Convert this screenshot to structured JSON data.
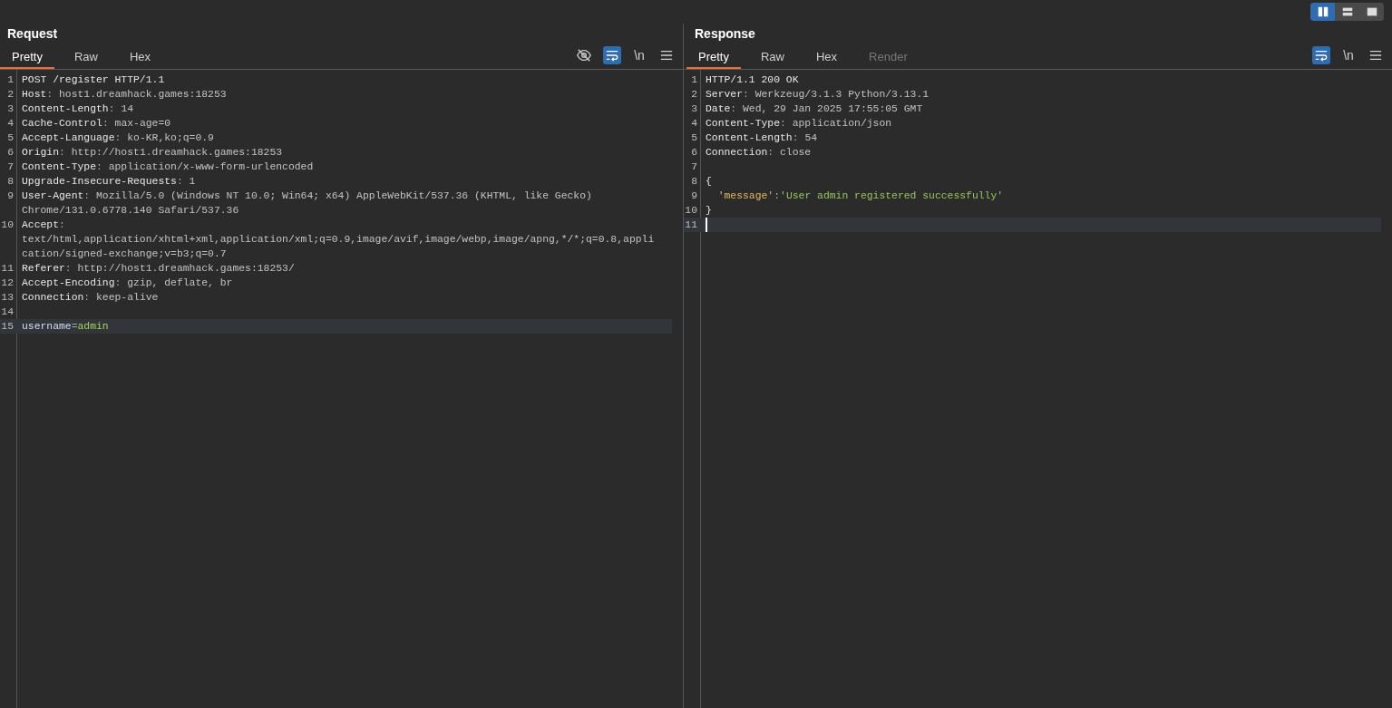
{
  "view_toggles": [
    {
      "kind": "columns",
      "selected": true
    },
    {
      "kind": "rows",
      "selected": false
    },
    {
      "kind": "single",
      "selected": false
    }
  ],
  "panels": [
    {
      "title": "Request",
      "tabs": [
        {
          "label": "Pretty",
          "selected": true,
          "disabled": false
        },
        {
          "label": "Raw",
          "selected": false,
          "disabled": false
        },
        {
          "label": "Hex",
          "selected": false,
          "disabled": false
        }
      ],
      "tools": [
        {
          "kind": "hide",
          "selected": false
        },
        {
          "kind": "wrap",
          "selected": true
        },
        {
          "kind": "text",
          "label": "\\n",
          "selected": false
        },
        {
          "kind": "menu",
          "selected": false
        }
      ],
      "lines": [
        {
          "number": "1",
          "current": false,
          "rows": [
            [
              {
                "kind": "plain",
                "text": "POST /register HTTP/1.1"
              }
            ]
          ]
        },
        {
          "number": "2",
          "current": false,
          "rows": [
            [
              {
                "kind": "name",
                "text": "Host"
              },
              {
                "kind": "punct",
                "text": ": "
              },
              {
                "kind": "value",
                "text": "host1.dreamhack.games:18253"
              }
            ]
          ]
        },
        {
          "number": "3",
          "current": false,
          "rows": [
            [
              {
                "kind": "name",
                "text": "Content-Length"
              },
              {
                "kind": "punct",
                "text": ": "
              },
              {
                "kind": "value",
                "text": "14"
              }
            ]
          ]
        },
        {
          "number": "4",
          "current": false,
          "rows": [
            [
              {
                "kind": "name",
                "text": "Cache-Control"
              },
              {
                "kind": "punct",
                "text": ": "
              },
              {
                "kind": "value",
                "text": "max-age=0"
              }
            ]
          ]
        },
        {
          "number": "5",
          "current": false,
          "rows": [
            [
              {
                "kind": "name",
                "text": "Accept-Language"
              },
              {
                "kind": "punct",
                "text": ": "
              },
              {
                "kind": "value",
                "text": "ko-KR,ko;q=0.9"
              }
            ]
          ]
        },
        {
          "number": "6",
          "current": false,
          "rows": [
            [
              {
                "kind": "name",
                "text": "Origin"
              },
              {
                "kind": "punct",
                "text": ": "
              },
              {
                "kind": "value",
                "text": "http://host1.dreamhack.games:18253"
              }
            ]
          ]
        },
        {
          "number": "7",
          "current": false,
          "rows": [
            [
              {
                "kind": "name",
                "text": "Content-Type"
              },
              {
                "kind": "punct",
                "text": ": "
              },
              {
                "kind": "value",
                "text": "application/x-www-form-urlencoded"
              }
            ]
          ]
        },
        {
          "number": "8",
          "current": false,
          "rows": [
            [
              {
                "kind": "name",
                "text": "Upgrade-Insecure-Requests"
              },
              {
                "kind": "punct",
                "text": ": "
              },
              {
                "kind": "value",
                "text": "1"
              }
            ]
          ]
        },
        {
          "number": "9",
          "current": false,
          "rows": [
            [
              {
                "kind": "name",
                "text": "User-Agent"
              },
              {
                "kind": "punct",
                "text": ": "
              },
              {
                "kind": "value",
                "text": "Mozilla/5.0 (Windows NT 10.0; Win64; x64) AppleWebKit/537.36 (KHTML, like Gecko)"
              }
            ],
            [
              {
                "kind": "value",
                "text": "Chrome/131.0.6778.140 Safari/537.36"
              }
            ]
          ]
        },
        {
          "number": "10",
          "current": false,
          "rows": [
            [
              {
                "kind": "name",
                "text": "Accept"
              },
              {
                "kind": "punct",
                "text": ":"
              }
            ],
            [
              {
                "kind": "value",
                "text": "text/html,application/xhtml+xml,application/xml;q=0.9,image/avif,image/webp,image/apng,*/*;q=0.8,appli"
              }
            ],
            [
              {
                "kind": "value",
                "text": "cation/signed-exchange;v=b3;q=0.7"
              }
            ]
          ]
        },
        {
          "number": "11",
          "current": false,
          "rows": [
            [
              {
                "kind": "name",
                "text": "Referer"
              },
              {
                "kind": "punct",
                "text": ": "
              },
              {
                "kind": "value",
                "text": "http://host1.dreamhack.games:18253/"
              }
            ]
          ]
        },
        {
          "number": "12",
          "current": false,
          "rows": [
            [
              {
                "kind": "name",
                "text": "Accept-Encoding"
              },
              {
                "kind": "punct",
                "text": ": "
              },
              {
                "kind": "value",
                "text": "gzip, deflate, br"
              }
            ]
          ]
        },
        {
          "number": "13",
          "current": false,
          "rows": [
            [
              {
                "kind": "name",
                "text": "Connection"
              },
              {
                "kind": "punct",
                "text": ": "
              },
              {
                "kind": "value",
                "text": "keep-alive"
              }
            ]
          ]
        },
        {
          "number": "14",
          "current": false,
          "rows": [
            []
          ]
        },
        {
          "number": "15",
          "current": true,
          "rows": [
            [
              {
                "kind": "param-name",
                "text": "username"
              },
              {
                "kind": "punct",
                "text": "="
              },
              {
                "kind": "param-value",
                "text": "admin"
              }
            ]
          ]
        }
      ]
    },
    {
      "title": "Response",
      "tabs": [
        {
          "label": "Pretty",
          "selected": true,
          "disabled": false
        },
        {
          "label": "Raw",
          "selected": false,
          "disabled": false
        },
        {
          "label": "Hex",
          "selected": false,
          "disabled": false
        },
        {
          "label": "Render",
          "selected": false,
          "disabled": true
        }
      ],
      "tools": [
        {
          "kind": "wrap",
          "selected": true
        },
        {
          "kind": "text",
          "label": "\\n",
          "selected": false
        },
        {
          "kind": "menu",
          "selected": false
        }
      ],
      "lines": [
        {
          "number": "1",
          "current": false,
          "rows": [
            [
              {
                "kind": "plain",
                "text": "HTTP/1.1 200 OK"
              }
            ]
          ]
        },
        {
          "number": "2",
          "current": false,
          "rows": [
            [
              {
                "kind": "name",
                "text": "Server"
              },
              {
                "kind": "punct",
                "text": ": "
              },
              {
                "kind": "value",
                "text": "Werkzeug/3.1.3 Python/3.13.1"
              }
            ]
          ]
        },
        {
          "number": "3",
          "current": false,
          "rows": [
            [
              {
                "kind": "name",
                "text": "Date"
              },
              {
                "kind": "punct",
                "text": ": "
              },
              {
                "kind": "value",
                "text": "Wed, 29 Jan 2025 17:55:05 GMT"
              }
            ]
          ]
        },
        {
          "number": "4",
          "current": false,
          "rows": [
            [
              {
                "kind": "name",
                "text": "Content-Type"
              },
              {
                "kind": "punct",
                "text": ": "
              },
              {
                "kind": "value",
                "text": "application/json"
              }
            ]
          ]
        },
        {
          "number": "5",
          "current": false,
          "rows": [
            [
              {
                "kind": "name",
                "text": "Content-Length"
              },
              {
                "kind": "punct",
                "text": ": "
              },
              {
                "kind": "value",
                "text": "54"
              }
            ]
          ]
        },
        {
          "number": "6",
          "current": false,
          "rows": [
            [
              {
                "kind": "name",
                "text": "Connection"
              },
              {
                "kind": "punct",
                "text": ": "
              },
              {
                "kind": "value",
                "text": "close"
              }
            ]
          ]
        },
        {
          "number": "7",
          "current": false,
          "rows": [
            []
          ]
        },
        {
          "number": "8",
          "current": false,
          "rows": [
            [
              {
                "kind": "plain",
                "text": "{"
              }
            ]
          ]
        },
        {
          "number": "9",
          "current": false,
          "rows": [
            [
              {
                "kind": "plain",
                "text": "  "
              },
              {
                "kind": "json-key",
                "text": "'message'"
              },
              {
                "kind": "punct",
                "text": ":"
              },
              {
                "kind": "json-string",
                "text": "'User admin registered successfully'"
              }
            ]
          ]
        },
        {
          "number": "10",
          "current": false,
          "rows": [
            [
              {
                "kind": "plain",
                "text": "}"
              }
            ]
          ]
        },
        {
          "number": "11",
          "current": true,
          "cursor": true,
          "rows": [
            []
          ]
        }
      ]
    }
  ]
}
